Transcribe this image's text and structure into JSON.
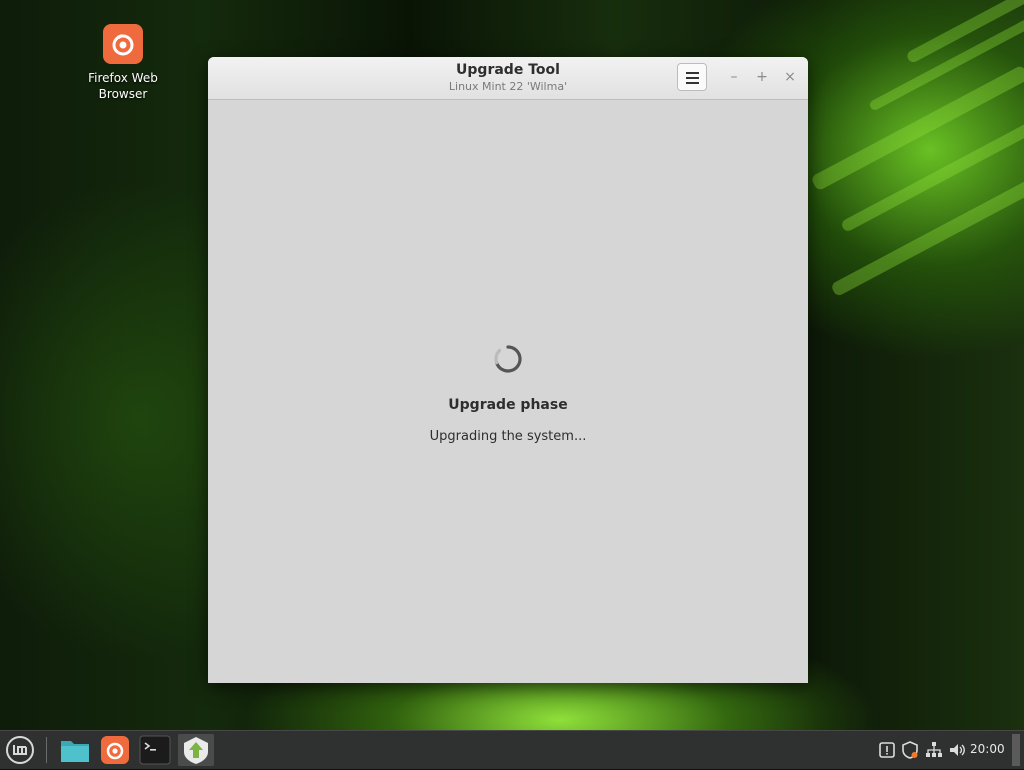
{
  "desktop": {
    "icons": [
      {
        "label_line1": "Firefox Web",
        "label_line2": "Browser",
        "icon": "firefox-icon"
      }
    ]
  },
  "window": {
    "title": "Upgrade Tool",
    "subtitle": "Linux Mint 22 'Wilma'",
    "menu_icon": "hamburger-menu-icon",
    "controls": {
      "minimize": "–",
      "maximize": "+",
      "close": "×"
    },
    "phase_title": "Upgrade phase",
    "status_text": "Upgrading the system..."
  },
  "taskbar": {
    "launchers": [
      "mint-menu-icon",
      "files-icon",
      "firefox-icon",
      "terminal-icon",
      "mintupgrade-icon"
    ],
    "tray": [
      "notification-icon",
      "update-manager-icon",
      "network-icon",
      "volume-icon"
    ],
    "clock": "20:00"
  },
  "colors": {
    "firefox_orange": "#ef6a3c",
    "panel_bg": "#2f3030",
    "window_bg": "#d6d6d6"
  }
}
